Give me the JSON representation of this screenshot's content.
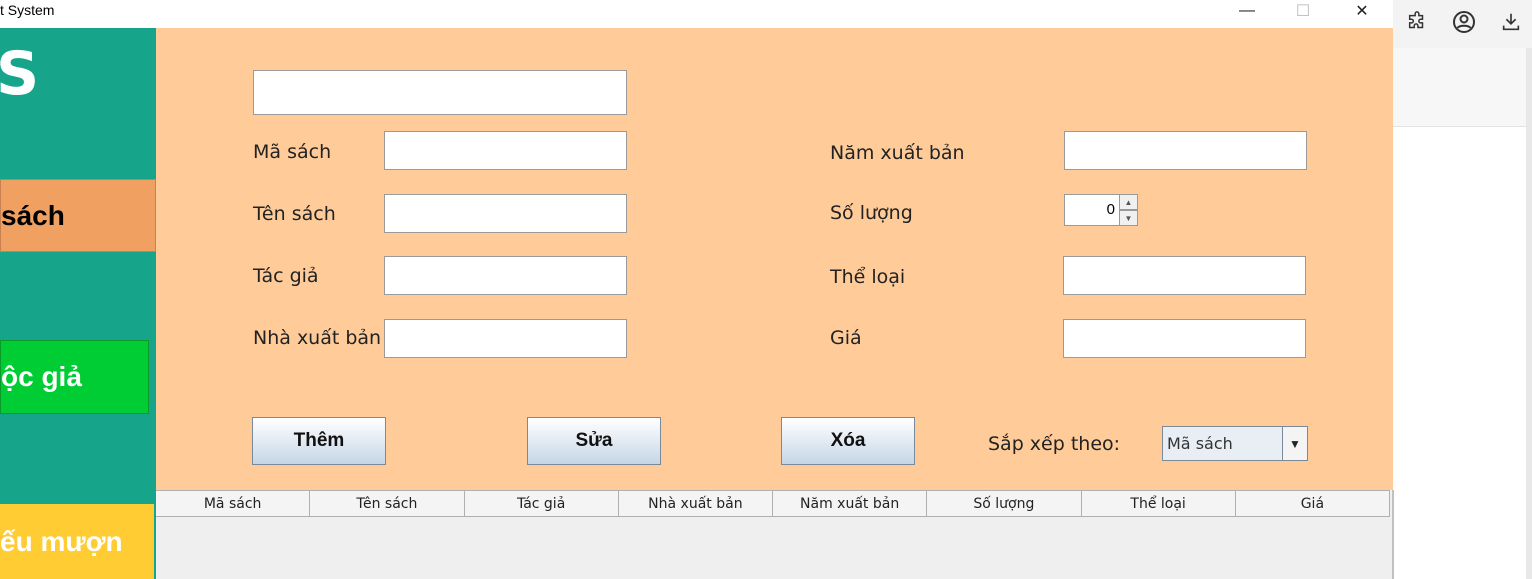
{
  "window": {
    "title": "t System",
    "minimize_glyph": "—",
    "maximize_glyph": "☐",
    "close_glyph": "✕"
  },
  "browser": {
    "icons": [
      "puzzle-icon",
      "profile-icon",
      "download-icon"
    ]
  },
  "sidebar": {
    "logo": "S",
    "items": [
      {
        "label": "sách",
        "color": "#f0a060"
      },
      {
        "label": "ộc giả",
        "color": "#00cc33"
      },
      {
        "label": "ếu mượn",
        "color": "#ffcc33"
      }
    ]
  },
  "form": {
    "search_value": "",
    "labels": {
      "ma_sach": "Mã sách",
      "ten_sach": "Tên sách",
      "tac_gia": "Tác giả",
      "nha_xuat_ban": "Nhà xuất bản",
      "nam_xuat_ban": "Năm xuất bản",
      "so_luong": "Số lượng",
      "the_loai": "Thể loại",
      "gia": "Giá"
    },
    "so_luong_value": "0"
  },
  "buttons": {
    "add": "Thêm",
    "edit": "Sửa",
    "delete": "Xóa"
  },
  "sort": {
    "label": "Sắp xếp theo:",
    "selected": "Mã sách"
  },
  "table": {
    "columns": [
      "Mã sách",
      "Tên sách",
      "Tác giả",
      "Nhà xuất bản",
      "Năm xuất bản",
      "Số lượng",
      "Thể loại",
      "Giá"
    ],
    "rows": []
  },
  "colors": {
    "sidebar_bg": "#16a48a",
    "main_bg": "#ffcc99"
  }
}
